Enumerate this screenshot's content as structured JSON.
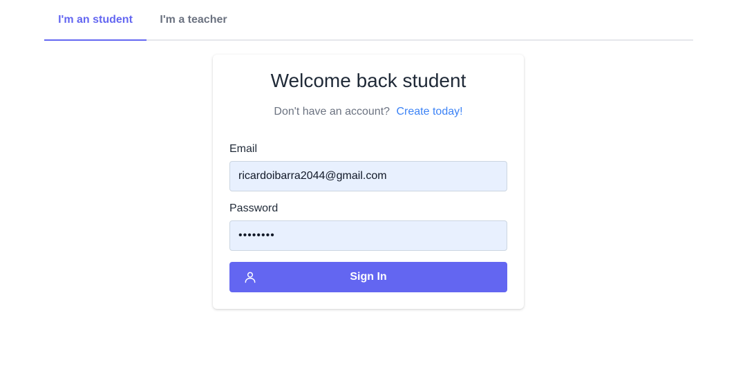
{
  "tabs": {
    "student": "I'm an student",
    "teacher": "I'm a teacher"
  },
  "card": {
    "title": "Welcome back student",
    "signup_prompt": "Don't have an account?",
    "signup_link": "Create today!",
    "email_label": "Email",
    "email_value": "ricardoibarra2044@gmail.com",
    "password_label": "Password",
    "password_value": "••••••••",
    "signin_label": "Sign In",
    "signin_icon": "user-icon"
  },
  "colors": {
    "accent": "#6366f1",
    "link": "#3b82f6",
    "input_bg": "#e8f0fe"
  }
}
